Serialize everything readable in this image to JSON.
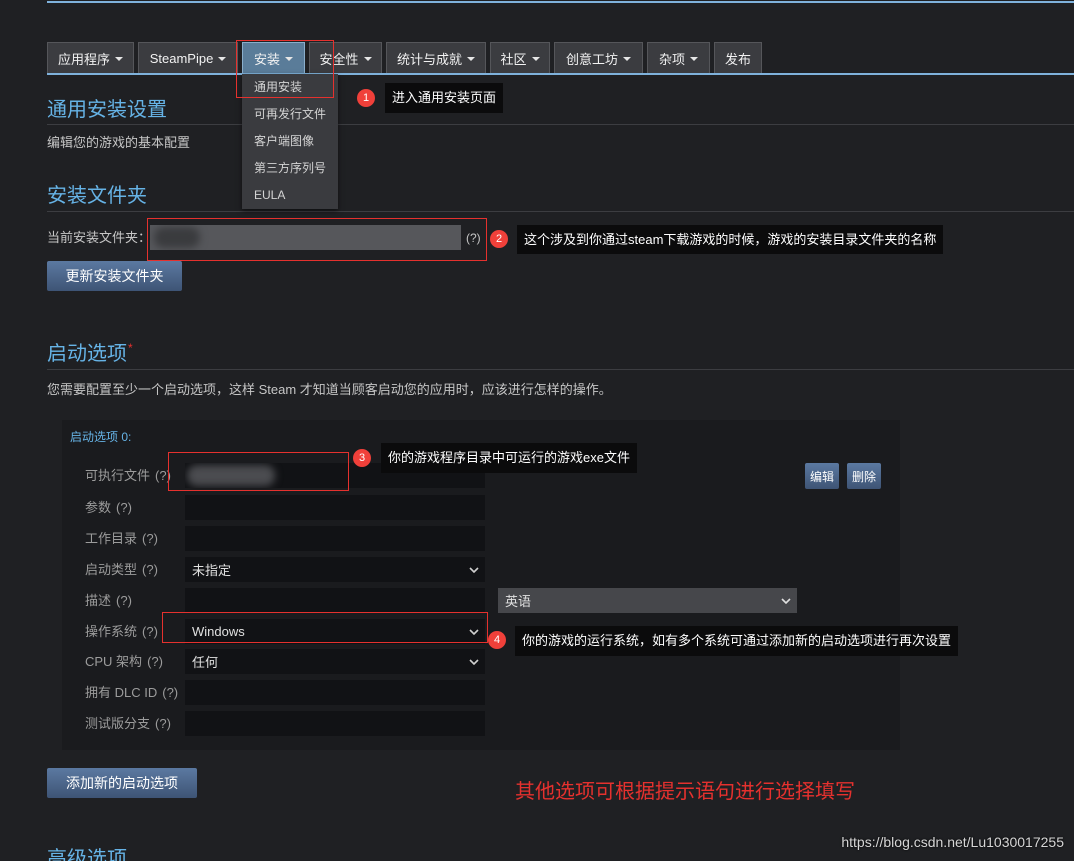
{
  "colors": {
    "accent": "#66b3e6",
    "annotation": "#e5312e",
    "active_tab": "#5a7c99"
  },
  "nav": {
    "tabs": [
      {
        "label": "应用程序",
        "dropdown": true
      },
      {
        "label": "SteamPipe",
        "dropdown": true
      },
      {
        "label": "安装",
        "dropdown": true,
        "active": true
      },
      {
        "label": "安全性",
        "dropdown": true
      },
      {
        "label": "统计与成就",
        "dropdown": true
      },
      {
        "label": "社区",
        "dropdown": true
      },
      {
        "label": "创意工坊",
        "dropdown": true
      },
      {
        "label": "杂项",
        "dropdown": true
      },
      {
        "label": "发布",
        "dropdown": false
      }
    ],
    "install_menu": [
      "通用安装",
      "可再发行文件",
      "客户端图像",
      "第三方序列号",
      "EULA"
    ]
  },
  "general": {
    "title": "通用安装设置",
    "description": "编辑您的游戏的基本配置"
  },
  "install_folder": {
    "title": "安装文件夹",
    "label": "当前安装文件夹：",
    "help": "(?)",
    "update_button": "更新安装文件夹"
  },
  "launch": {
    "title": "启动选项",
    "required_mark": "*",
    "description": "您需要配置至少一个启动选项，这样 Steam 才知道当顾客启动您的应用时，应该进行怎样的操作。",
    "option_title": "启动选项 0:",
    "edit_button": "编辑",
    "delete_button": "删除",
    "fields": {
      "executable": {
        "label": "可执行文件",
        "help": "(?)"
      },
      "arguments": {
        "label": "参数",
        "help": "(?)"
      },
      "working_dir": {
        "label": "工作目录",
        "help": "(?)"
      },
      "launch_type": {
        "label": "启动类型",
        "help": "(?)",
        "value": "未指定"
      },
      "description": {
        "label": "描述",
        "help": "(?)",
        "language": "英语"
      },
      "os": {
        "label": "操作系统",
        "help": "(?)",
        "value": "Windows"
      },
      "cpu": {
        "label": "CPU 架构",
        "help": "(?)",
        "value": "任何"
      },
      "dlc": {
        "label": "拥有 DLC ID",
        "help": "(?)"
      },
      "beta": {
        "label": "测试版分支",
        "help": "(?)"
      }
    },
    "add_button": "添加新的启动选项"
  },
  "advanced": {
    "title": "高级选项"
  },
  "annotations": [
    {
      "number": "1",
      "text": "进入通用安装页面"
    },
    {
      "number": "2",
      "text": "这个涉及到你通过steam下载游戏的时候，游戏的安装目录文件夹的名称"
    },
    {
      "number": "3",
      "text": "你的游戏程序目录中可运行的游戏exe文件"
    },
    {
      "number": "4",
      "text": "你的游戏的运行系统，如有多个系统可通过添加新的启动选项进行再次设置"
    }
  ],
  "note": "其他选项可根据提示语句进行选择填写",
  "watermark": "https://blog.csdn.net/Lu1030017255"
}
